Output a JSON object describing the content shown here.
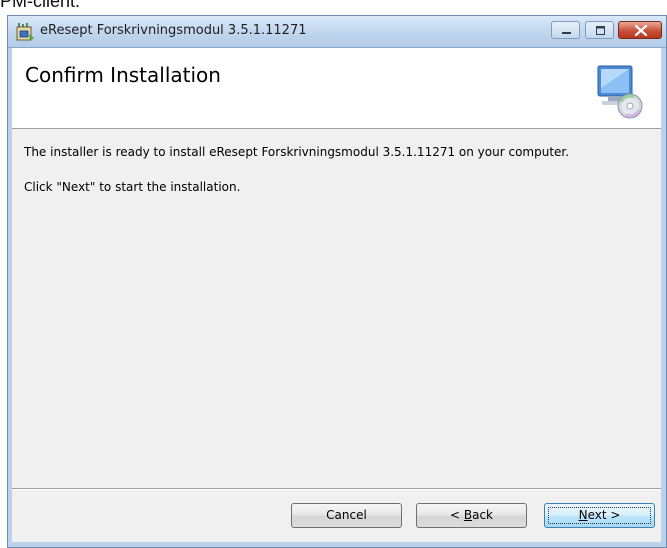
{
  "doc_caption": "PM-client.",
  "window": {
    "title": "eResept Forskrivningsmodul 3.5.1.11271",
    "controls": {
      "minimize_icon": "minimize-icon",
      "maximize_icon": "maximize-icon",
      "close_icon": "close-icon"
    }
  },
  "banner": {
    "title": "Confirm Installation",
    "icon": "computer-cd-icon"
  },
  "content": {
    "line1": "The installer is ready to install eResept Forskrivningsmodul 3.5.1.11271 on your computer.",
    "line2": "Click \"Next\" to start the installation."
  },
  "buttons": {
    "cancel": "Cancel",
    "back_prefix": "< ",
    "back_mnemonic": "B",
    "back_rest": "ack",
    "next_mnemonic": "N",
    "next_rest": "ext >"
  },
  "colors": {
    "titlebar": "#c2d7ef",
    "client_bg": "#f0f0f0",
    "close_button": "#c9503a",
    "next_button": "#bee6fd"
  }
}
